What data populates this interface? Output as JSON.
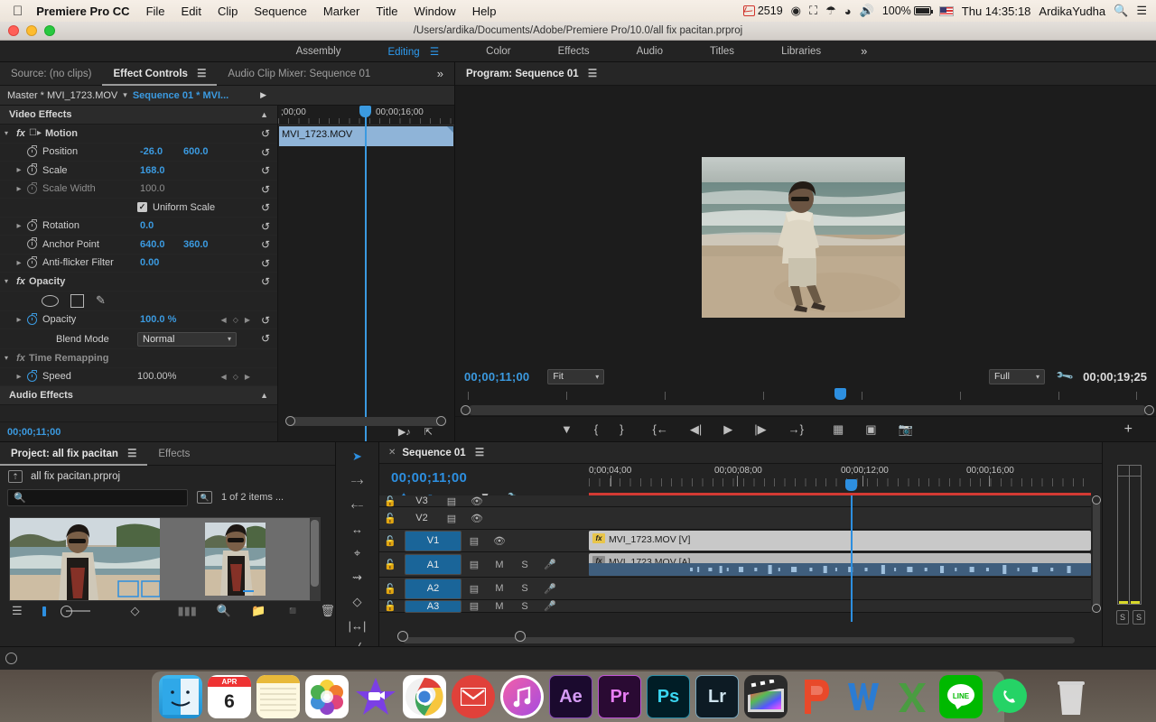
{
  "macos": {
    "apple_icon": "apple-icon",
    "app_name": "Premiere Pro CC",
    "menus": [
      "File",
      "Edit",
      "Clip",
      "Sequence",
      "Marker",
      "Title",
      "Window",
      "Help"
    ],
    "status": {
      "mail_count": "2519",
      "creative_cloud_icon": "creative-cloud-icon",
      "airplay_icon": "airplay-icon",
      "dropbox_icon": "dropbox-icon",
      "wifi_icon": "wifi-icon",
      "volume_icon": "volume-icon",
      "battery_percent": "100%",
      "flag_icon": "us-flag-icon",
      "datetime": "Thu 14:35:18",
      "user": "ArdikaYudha",
      "search_icon": "search-icon",
      "notification_icon": "notification-center-icon"
    }
  },
  "window": {
    "document_path": "/Users/ardika/Documents/Adobe/Premiere Pro/10.0/all fix pacitan.prproj"
  },
  "workspaces": {
    "items": [
      "Assembly",
      "Editing",
      "Color",
      "Effects",
      "Audio",
      "Titles",
      "Libraries"
    ],
    "active": "Editing",
    "overflow": "»"
  },
  "effect_controls": {
    "tabs": [
      {
        "label": "Source: (no clips)",
        "active": false
      },
      {
        "label": "Effect Controls",
        "active": true
      },
      {
        "label": "Audio Clip Mixer: Sequence 01",
        "active": false
      }
    ],
    "overflow": "»",
    "master_label": "Master * MVI_1723.MOV",
    "sequence_label": "Sequence 01 * MVI...",
    "video_effects_header": "Video Effects",
    "audio_effects_header": "Audio Effects",
    "motion": {
      "name": "Motion",
      "params": [
        {
          "label": "Position",
          "value": "-26.0",
          "value2": "600.0",
          "dim": false,
          "expand": false
        },
        {
          "label": "Scale",
          "value": "168.0",
          "dim": false,
          "expand": true
        },
        {
          "label": "Scale Width",
          "value": "100.0",
          "dim": true,
          "expand": true
        },
        {
          "label": "Rotation",
          "value": "0.0",
          "dim": false,
          "expand": true
        },
        {
          "label": "Anchor Point",
          "value": "640.0",
          "value2": "360.0",
          "dim": false,
          "expand": false
        },
        {
          "label": "Anti-flicker Filter",
          "value": "0.00",
          "dim": false,
          "expand": true
        }
      ],
      "uniform_scale_label": "Uniform Scale",
      "uniform_scale_checked": true
    },
    "opacity": {
      "name": "Opacity",
      "value_label": "Opacity",
      "value": "100.0 %",
      "blend_mode_label": "Blend Mode",
      "blend_mode_value": "Normal",
      "mask_tools": [
        "ellipse-mask-icon",
        "rectangle-mask-icon",
        "pen-mask-icon"
      ]
    },
    "time_remapping": {
      "name": "Time Remapping",
      "speed_label": "Speed",
      "speed_value": "100.00%"
    },
    "timecode": "00;00;11;00",
    "ruler": {
      "start": ";00;00",
      "mid": "00;00;16;00"
    },
    "clip_name": "MVI_1723.MOV",
    "reset_icon": "reset-icon"
  },
  "program_monitor": {
    "tab_label": "Program: Sequence 01",
    "menu_icon": "panel-menu-icon",
    "current_time": "00;00;11;00",
    "fit_label": "Fit",
    "quality_label": "Full",
    "settings_icon": "wrench-icon",
    "duration": "00;00;19;25",
    "transport": [
      "add-marker-icon",
      "mark-in-icon",
      "mark-out-icon",
      "go-to-in-icon",
      "step-back-icon",
      "play-icon",
      "step-forward-icon",
      "go-to-out-icon",
      "lift-icon",
      "extract-icon",
      "export-frame-icon"
    ],
    "button_editor": "+"
  },
  "project_panel": {
    "tabs": [
      {
        "label": "Project: all fix pacitan",
        "active": true
      },
      {
        "label": "Effects",
        "active": false
      }
    ],
    "menu_icon": "panel-menu-icon",
    "root_label": "all fix pacitan.prproj",
    "search_placeholder": "",
    "search_value": "",
    "item_count": "1 of 2 items ...",
    "footer_icons": [
      "list-view-icon",
      "icon-view-icon",
      "zoom-slider",
      "sort-icon",
      "automate-to-sequence-icon",
      "find-icon",
      "new-bin-icon",
      "new-item-icon",
      "delete-icon"
    ]
  },
  "tools": [
    "selection-tool",
    "track-select-forward-tool",
    "track-select-backward-tool",
    "ripple-edit-tool",
    "rolling-edit-tool",
    "rate-stretch-tool",
    "slip-tool",
    "slide-tool",
    "pen-tool"
  ],
  "timeline": {
    "tab_label": "Sequence 01",
    "close_icon": "close-icon",
    "menu_icon": "panel-menu-icon",
    "current_time": "00;00;11;00",
    "tool_icons": [
      "insert-overwrite-icon",
      "snap-icon",
      "linked-selection-icon",
      "add-marker-icon",
      "timeline-settings-icon"
    ],
    "ruler_labels": [
      "0;00;04;00",
      "00;00;08;00",
      "00;00;12;00",
      "00;00;16;00"
    ],
    "tracks": [
      {
        "name": "V3",
        "type": "video",
        "selected": false,
        "clip": null
      },
      {
        "name": "V2",
        "type": "video",
        "selected": false,
        "clip": null
      },
      {
        "name": "V1",
        "type": "video",
        "selected": true,
        "clip": "MVI_1723.MOV [V]"
      },
      {
        "name": "A1",
        "type": "audio",
        "selected": true,
        "clip": "MVI_1723.MOV [A]",
        "mute": "M",
        "solo": "S"
      },
      {
        "name": "A2",
        "type": "audio",
        "selected": true,
        "clip": null,
        "mute": "M",
        "solo": "S"
      },
      {
        "name": "A3",
        "type": "audio",
        "selected": true,
        "clip": null,
        "mute": "M",
        "solo": "S"
      }
    ],
    "fx_badge": "fx"
  },
  "audio_meters": {
    "solo_labels": [
      "S",
      "S"
    ]
  },
  "dock": {
    "items": [
      {
        "name": "finder",
        "label": "",
        "bg": "#2ba9e8",
        "running": true
      },
      {
        "name": "calendar",
        "label": "6",
        "sub": "APR",
        "bg": "#ffffff",
        "running": false
      },
      {
        "name": "notes",
        "label": "",
        "bg": "#fdf3c8",
        "running": true
      },
      {
        "name": "photos",
        "label": "",
        "bg": "#ffffff",
        "running": false
      },
      {
        "name": "imovie",
        "label": "",
        "bg": "#6b3fd4",
        "running": false
      },
      {
        "name": "chrome",
        "label": "",
        "bg": "#ffffff",
        "running": true
      },
      {
        "name": "mail",
        "label": "",
        "bg": "#e0413a",
        "running": false
      },
      {
        "name": "itunes",
        "label": "",
        "bg": "#ffffff",
        "running": false
      },
      {
        "name": "after-effects",
        "label": "Ae",
        "bg": "#1b0a2e",
        "fg": "#d59cf5",
        "running": false
      },
      {
        "name": "premiere-pro",
        "label": "Pr",
        "bg": "#2a0a33",
        "fg": "#e87ef5",
        "running": true
      },
      {
        "name": "photoshop",
        "label": "Ps",
        "bg": "#001d26",
        "fg": "#3ad5f0",
        "running": false
      },
      {
        "name": "lightroom",
        "label": "Lr",
        "bg": "#0d1b24",
        "fg": "#cfe4ef",
        "running": false
      },
      {
        "name": "final-cut-pro",
        "label": "",
        "bg": "#2b2b2b",
        "running": false
      },
      {
        "name": "powerpoint",
        "label": "P",
        "bg": "transparent",
        "fg": "#e8492a",
        "running": false
      },
      {
        "name": "word",
        "label": "W",
        "bg": "transparent",
        "fg": "#2b7cd3",
        "running": false
      },
      {
        "name": "excel",
        "label": "X",
        "bg": "transparent",
        "fg": "#4a9c41",
        "running": false
      },
      {
        "name": "line",
        "label": "LINE",
        "bg": "#00b900",
        "fg": "#ffffff",
        "running": false
      },
      {
        "name": "whatsapp",
        "label": "",
        "bg": "#25d366",
        "running": false
      },
      {
        "name": "trash",
        "label": "",
        "bg": "#dcdcdc",
        "running": false
      }
    ]
  },
  "colors": {
    "accent_blue": "#2d8fe0",
    "panel_bg": "#232323",
    "track_selected": "#1a6599",
    "clip_video": "#c8c8c8",
    "playhead": "#2d8fe0",
    "render_bar_red": "#d33a33"
  }
}
